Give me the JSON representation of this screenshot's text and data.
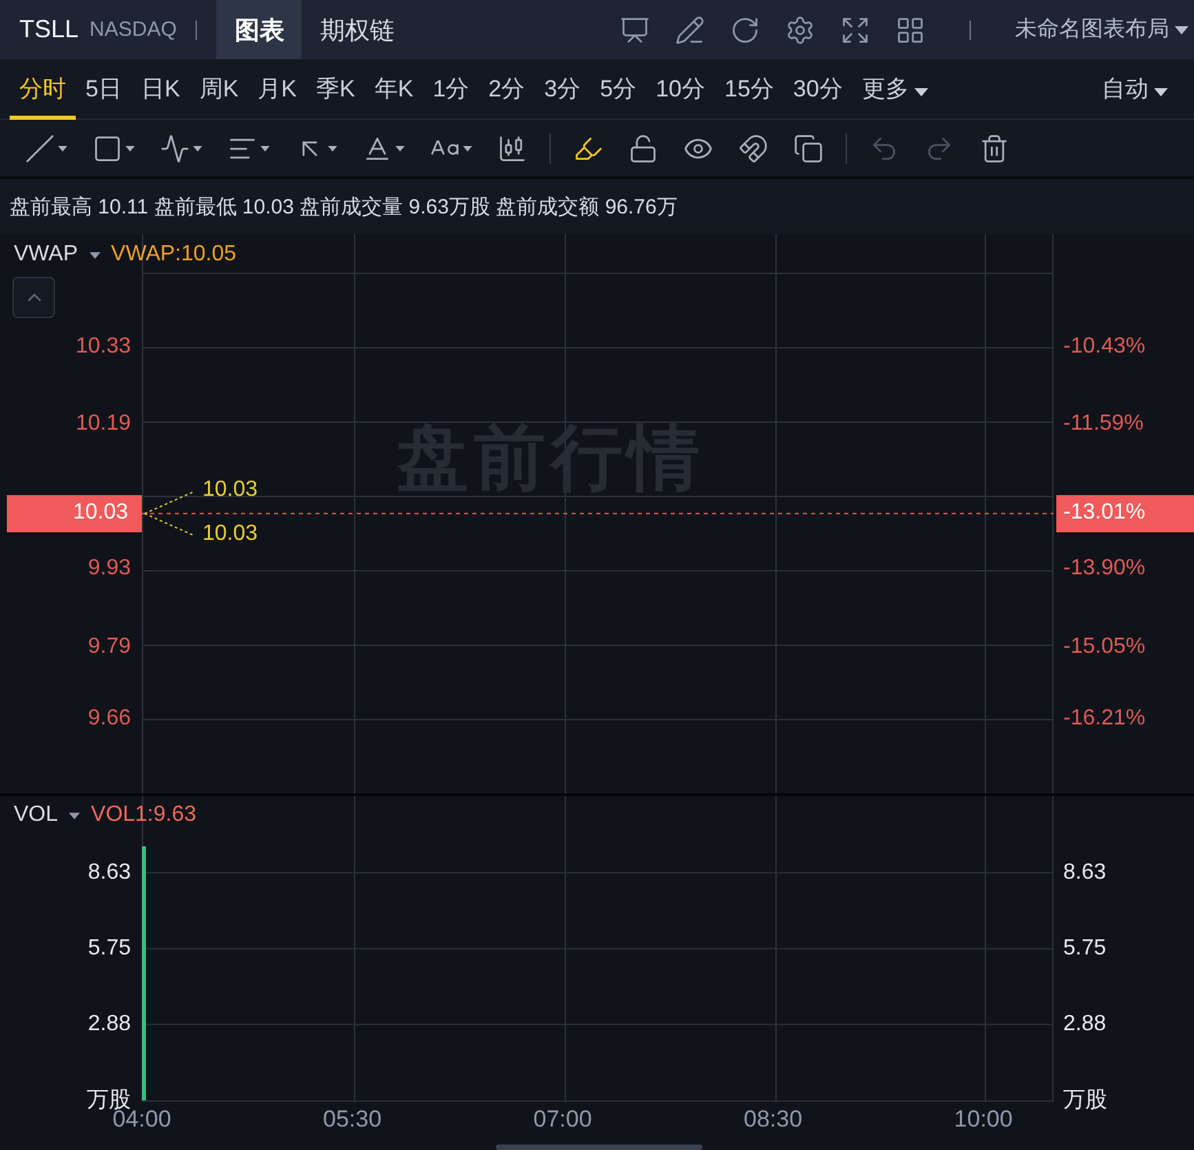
{
  "header": {
    "symbol": "TSLL",
    "exchange": "NASDAQ",
    "tabs": [
      {
        "label": "图表",
        "selected": true
      },
      {
        "label": "期权链",
        "selected": false
      }
    ],
    "layout_name": "未命名图表布局"
  },
  "periods": [
    {
      "label": "分时",
      "selected": true
    },
    {
      "label": "5日",
      "selected": false
    },
    {
      "label": "日K",
      "selected": false
    },
    {
      "label": "周K",
      "selected": false
    },
    {
      "label": "月K",
      "selected": false
    },
    {
      "label": "季K",
      "selected": false
    },
    {
      "label": "年K",
      "selected": false
    },
    {
      "label": "1分",
      "selected": false
    },
    {
      "label": "2分",
      "selected": false
    },
    {
      "label": "3分",
      "selected": false
    },
    {
      "label": "5分",
      "selected": false
    },
    {
      "label": "10分",
      "selected": false
    },
    {
      "label": "15分",
      "selected": false
    },
    {
      "label": "30分",
      "selected": false
    }
  ],
  "more_label": "更多",
  "scale_mode": "自动",
  "drawing_tools": [
    {
      "has_menu": true,
      "selected": false,
      "disabled": false
    },
    {
      "has_menu": true,
      "selected": false,
      "disabled": false
    },
    {
      "has_menu": true,
      "selected": false,
      "disabled": false
    },
    {
      "has_menu": true,
      "selected": false,
      "disabled": false
    },
    {
      "has_menu": true,
      "selected": false,
      "disabled": false
    },
    {
      "has_menu": true,
      "selected": false,
      "disabled": false
    },
    {
      "has_menu": true,
      "selected": false,
      "disabled": false
    },
    {
      "has_menu": false,
      "selected": false,
      "disabled": false
    },
    {
      "has_menu": false,
      "selected": true,
      "disabled": false
    },
    {
      "has_menu": false,
      "selected": false,
      "disabled": false
    },
    {
      "has_menu": false,
      "selected": false,
      "disabled": false
    },
    {
      "has_menu": false,
      "selected": false,
      "disabled": false
    },
    {
      "has_menu": false,
      "selected": false,
      "disabled": false
    },
    {
      "has_menu": false,
      "selected": false,
      "disabled": true
    },
    {
      "has_menu": false,
      "selected": false,
      "disabled": true
    },
    {
      "has_menu": false,
      "selected": false,
      "disabled": false
    }
  ],
  "summary": "盘前最高 10.11 盘前最低 10.03 盘前成交量 9.63万股 盘前成交额 96.76万",
  "price_panel": {
    "indicator": "VWAP",
    "indicator_value": "VWAP:10.05",
    "session_label": "盘前行情",
    "ticks": [
      {
        "price": "10.33",
        "change": "-10.43%"
      },
      {
        "price": "10.19",
        "change": "-11.59%"
      },
      {
        "price": "9.93",
        "change": "-13.90%"
      },
      {
        "price": "9.79",
        "change": "-15.05%"
      },
      {
        "price": "9.66",
        "change": "-16.21%"
      }
    ],
    "current": {
      "price": "10.03",
      "change": "-13.01%"
    },
    "callouts": [
      "10.03",
      "10.03"
    ]
  },
  "volume_panel": {
    "indicator": "VOL",
    "indicator_value": "VOL1:9.63",
    "unit_right": "万股",
    "right_ticks": [
      "8.63",
      "5.75",
      "2.88"
    ],
    "chart_data": {
      "type": "bar",
      "x": [
        240
      ],
      "values": [
        9.63
      ],
      "ylabel": "万股",
      "xlim": [
        240,
        630
      ],
      "ylim": [
        0,
        9.63
      ],
      "grid": true,
      "yticks": [
        {
          "value": 2.88,
          "label": "2.88"
        },
        {
          "value": 5.75,
          "label": "5.75"
        },
        {
          "value": 8.63,
          "label": "8.63"
        }
      ],
      "xticks": [
        {
          "value": 240,
          "label": "04:00"
        },
        {
          "value": 330,
          "label": "05:30"
        },
        {
          "value": 420,
          "label": "07:00"
        },
        {
          "value": 510,
          "label": "08:30"
        },
        {
          "value": 600,
          "label": "10:00"
        }
      ]
    }
  }
}
